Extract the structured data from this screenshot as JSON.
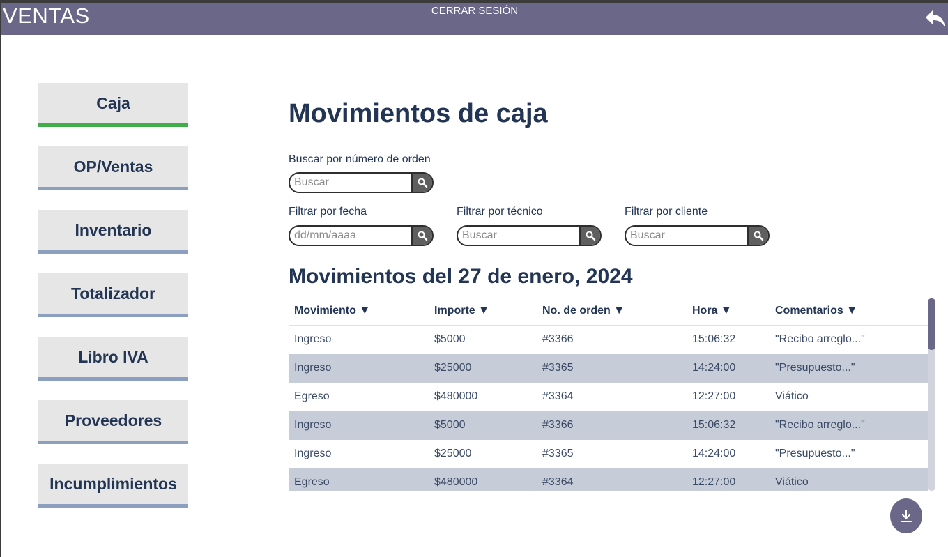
{
  "header": {
    "brand": "VENTAS",
    "logout_label": "CERRAR SESIÓN",
    "back_icon": "undo-arrow-icon",
    "color": "#6a6789"
  },
  "sidebar": {
    "items": [
      {
        "label": "Caja",
        "active": true
      },
      {
        "label": "OP/Ventas",
        "active": false
      },
      {
        "label": "Inventario",
        "active": false
      },
      {
        "label": "Totalizador",
        "active": false
      },
      {
        "label": "Libro IVA",
        "active": false
      },
      {
        "label": "Proveedores",
        "active": false
      },
      {
        "label": "Incumplimientos",
        "active": false
      }
    ],
    "active_color": "#3fae49",
    "inactive_color": "#8d9fbf"
  },
  "main": {
    "title": "Movimientos de caja",
    "search_order": {
      "label": "Buscar por número de orden",
      "placeholder": "Buscar"
    },
    "filter_date": {
      "label": "Filtrar por fecha",
      "placeholder": "dd/mm/aaaa"
    },
    "filter_tech": {
      "label": "Filtrar por técnico",
      "placeholder": "Buscar"
    },
    "filter_client": {
      "label": "Filtrar por cliente",
      "placeholder": "Buscar"
    },
    "subtitle": "Movimientos del 27 de enero, 2024"
  },
  "table": {
    "columns": [
      "Movimiento ▼",
      "Importe ▼",
      "No. de orden ▼",
      "Hora ▼",
      "Comentarios ▼"
    ],
    "rows": [
      [
        "Ingreso",
        "$5000",
        "#3366",
        "15:06:32",
        "\"Recibo arreglo...\""
      ],
      [
        "Ingreso",
        "$25000",
        "#3365",
        "14:24:00",
        "\"Presupuesto...\""
      ],
      [
        "Egreso",
        "$480000",
        "#3364",
        "12:27:00",
        "Viático"
      ],
      [
        "Ingreso",
        "$5000",
        "#3366",
        "15:06:32",
        "\"Recibo arreglo...\""
      ],
      [
        "Ingreso",
        "$25000",
        "#3365",
        "14:24:00",
        "\"Presupuesto...\""
      ],
      [
        "Egreso",
        "$480000",
        "#3364",
        "12:27:00",
        "Viático"
      ]
    ]
  },
  "icons": {
    "search": "search-icon",
    "download": "download-icon"
  }
}
